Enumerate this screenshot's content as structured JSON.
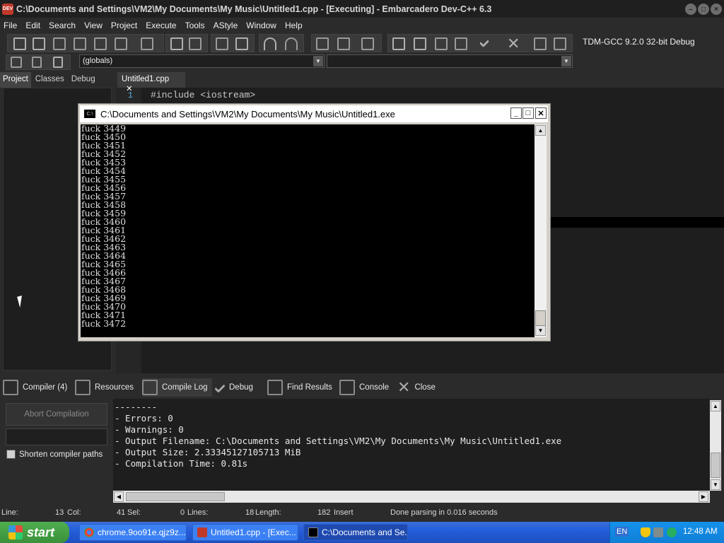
{
  "window": {
    "title": "C:\\Documents and Settings\\VM2\\My Documents\\My Music\\Untitled1.cpp - [Executing] - Embarcadero Dev-C++ 6.3",
    "icon_label": "DEV"
  },
  "menu": [
    "File",
    "Edit",
    "Search",
    "View",
    "Project",
    "Execute",
    "Tools",
    "AStyle",
    "Window",
    "Help"
  ],
  "toolbar": {
    "compiler_select": "TDM-GCC 9.2.0 32-bit Debug",
    "globals_select": "(globals)"
  },
  "left_tabs": [
    "Project",
    "Classes",
    "Debug"
  ],
  "editor": {
    "tab_label": "Untitled1.cpp",
    "line_number": "1",
    "code": "#include <iostream>"
  },
  "console": {
    "title": "C:\\Documents and Settings\\VM2\\My Documents\\My Music\\Untitled1.exe",
    "icon_label": "C:\\",
    "lines": [
      "fuck 3449",
      "fuck 3450",
      "fuck 3451",
      "fuck 3452",
      "fuck 3453",
      "fuck 3454",
      "fuck 3455",
      "fuck 3456",
      "fuck 3457",
      "fuck 3458",
      "fuck 3459",
      "fuck 3460",
      "fuck 3461",
      "fuck 3462",
      "fuck 3463",
      "fuck 3464",
      "fuck 3465",
      "fuck 3466",
      "fuck 3467",
      "fuck 3468",
      "fuck 3469",
      "fuck 3470",
      "fuck 3471",
      "fuck 3472"
    ]
  },
  "bottom_tabs": {
    "compiler": "Compiler (4)",
    "resources": "Resources",
    "compile_log": "Compile Log",
    "debug": "Debug",
    "find_results": "Find Results",
    "console": "Console",
    "close": "Close"
  },
  "bottom_left": {
    "abort_label": "Abort Compilation",
    "shorten_label": "Shorten compiler paths"
  },
  "log_lines": [
    "--------",
    "- Errors: 0",
    "- Warnings: 0",
    "- Output Filename: C:\\Documents and Settings\\VM2\\My Documents\\My Music\\Untitled1.exe",
    "- Output Size: 2.33345127105713 MiB",
    "- Compilation Time: 0.81s"
  ],
  "status": {
    "line_label": "Line:",
    "line_value": "13",
    "col_label": "Col:",
    "col_value": "41",
    "sel_label": "Sel:",
    "sel_value": "0",
    "lines_label": "Lines:",
    "lines_value": "18",
    "length_label": "Length:",
    "length_value": "182",
    "mode": "Insert",
    "message": "Done parsing in 0.016 seconds"
  },
  "taskbar": {
    "start": "start",
    "tasks": [
      "chrome.9oo91e.qjz9z...",
      "Untitled1.cpp - [Exec...",
      "C:\\Documents and Se..."
    ],
    "tray_lang": "EN",
    "clock": "12:48 AM"
  }
}
